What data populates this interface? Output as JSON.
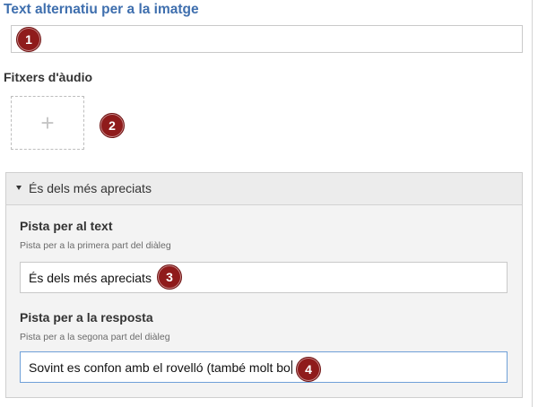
{
  "alt_text": {
    "label": "Text alternatiu per a la imatge",
    "value": ""
  },
  "audio": {
    "label": "Fitxers d'àudio",
    "add_symbol": "+"
  },
  "group": {
    "title": "És dels més apreciats",
    "text_hint": {
      "label": "Pista per al text",
      "description": "Pista per a la primera part del diàleg",
      "value": "És dels més apreciats"
    },
    "answer_hint": {
      "label": "Pista per a la resposta",
      "description": "Pista per a la segona part del diàleg",
      "value": "Sovint es confon amb el rovelló (també molt bo"
    }
  },
  "callouts": [
    "1",
    "2",
    "3",
    "4"
  ],
  "colors": {
    "title_blue": "#3f6fae",
    "badge_red": "#8f1b1b",
    "focus_border": "#6fa0d8"
  }
}
